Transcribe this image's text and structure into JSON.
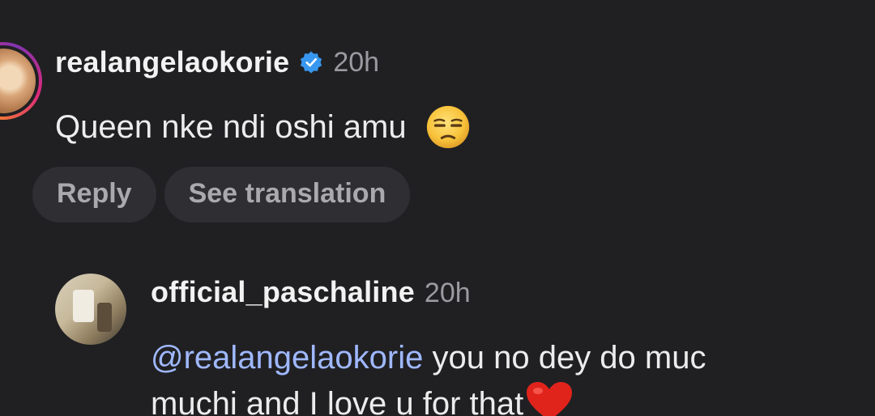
{
  "comment": {
    "username": "realangelaokorie",
    "verified": true,
    "time": "20h",
    "text": "Queen nke ndi oshi amu",
    "emoji": "unamused-face-icon",
    "actions": {
      "reply_label": "Reply",
      "translate_label": "See translation"
    }
  },
  "reply": {
    "username": "official_paschaline",
    "time": "20h",
    "mention": "@realangelaokorie",
    "line1": " you no dey do muc",
    "line2": "muchi and I love u for that",
    "emoji": "red-heart-icon"
  },
  "colors": {
    "background": "#202023",
    "pill_bg": "#2e2e33",
    "mention": "#9fb8ff",
    "verified": "#3897f0",
    "heart": "#e0241c"
  }
}
